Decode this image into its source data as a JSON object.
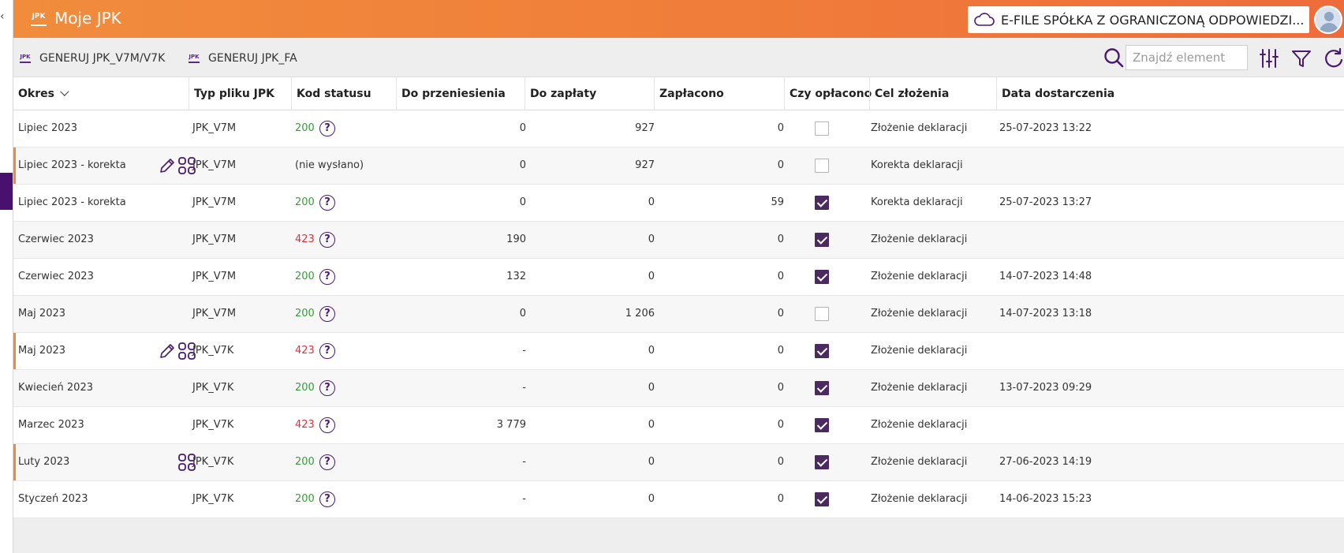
{
  "header": {
    "logo_text": "JPK",
    "title": "Moje JPK",
    "company": "E-FILE SPÓŁKA Z OGRANICZONĄ ODPOWIEDZI..."
  },
  "toolbar": {
    "buttons": [
      {
        "icon_text": "JPK",
        "label": "GENERUJ JPK_V7M/V7K"
      },
      {
        "icon_text": "JPK",
        "label": "GENERUJ JPK_FA"
      }
    ],
    "search_placeholder": "Znajdź element",
    "icons": [
      "search-icon",
      "column-settings-icon",
      "filter-icon",
      "refresh-icon"
    ]
  },
  "table": {
    "columns": [
      "Okres",
      "Typ pliku JPK",
      "Kod statusu",
      "Do przeniesienia",
      "Do zapłaty",
      "Zapłacono",
      "Czy opłacono",
      "Cel złożenia",
      "Data dostarczenia"
    ],
    "rows": [
      {
        "okres": "Lipiec 2023",
        "typ": "JPK_V7M",
        "kod": "200",
        "przen": "0",
        "zapl": "927",
        "zaplac": "0",
        "paid": false,
        "cel": "Złożenie deklaracji",
        "data": "25-07-2023 13:22",
        "flag": false,
        "edit": false,
        "apps": false
      },
      {
        "okres": "Lipiec 2023 - korekta",
        "typ": "JPK_V7M",
        "kod": "(nie wysłano)",
        "przen": "0",
        "zapl": "927",
        "zaplac": "0",
        "paid": false,
        "cel": "Korekta deklaracji",
        "data": "",
        "flag": true,
        "edit": true,
        "apps": true
      },
      {
        "okres": "Lipiec 2023 - korekta",
        "typ": "JPK_V7M",
        "kod": "200",
        "przen": "0",
        "zapl": "0",
        "zaplac": "59",
        "paid": true,
        "cel": "Korekta deklaracji",
        "data": "25-07-2023 13:27",
        "flag": false,
        "edit": false,
        "apps": false
      },
      {
        "okres": "Czerwiec 2023",
        "typ": "JPK_V7M",
        "kod": "423",
        "przen": "190",
        "zapl": "0",
        "zaplac": "0",
        "paid": true,
        "cel": "Złożenie deklaracji",
        "data": "",
        "flag": false,
        "edit": false,
        "apps": false
      },
      {
        "okres": "Czerwiec 2023",
        "typ": "JPK_V7M",
        "kod": "200",
        "przen": "132",
        "zapl": "0",
        "zaplac": "0",
        "paid": true,
        "cel": "Złożenie deklaracji",
        "data": "14-07-2023 14:48",
        "flag": false,
        "edit": false,
        "apps": false
      },
      {
        "okres": "Maj 2023",
        "typ": "JPK_V7M",
        "kod": "200",
        "przen": "0",
        "zapl": "1 206",
        "zaplac": "0",
        "paid": false,
        "cel": "Złożenie deklaracji",
        "data": "14-07-2023 13:18",
        "flag": false,
        "edit": false,
        "apps": false
      },
      {
        "okres": "Maj 2023",
        "typ": "JPK_V7K",
        "kod": "423",
        "przen": "-",
        "zapl": "0",
        "zaplac": "0",
        "paid": true,
        "cel": "Złożenie deklaracji",
        "data": "",
        "flag": true,
        "edit": true,
        "apps": true
      },
      {
        "okres": "Kwiecień 2023",
        "typ": "JPK_V7K",
        "kod": "200",
        "przen": "-",
        "zapl": "0",
        "zaplac": "0",
        "paid": true,
        "cel": "Złożenie deklaracji",
        "data": "13-07-2023 09:29",
        "flag": false,
        "edit": false,
        "apps": false
      },
      {
        "okres": "Marzec 2023",
        "typ": "JPK_V7K",
        "kod": "423",
        "przen": "3 779",
        "zapl": "0",
        "zaplac": "0",
        "paid": true,
        "cel": "Złożenie deklaracji",
        "data": "",
        "flag": false,
        "edit": false,
        "apps": false
      },
      {
        "okres": "Luty 2023",
        "typ": "JPK_V7K",
        "kod": "200",
        "przen": "-",
        "zapl": "0",
        "zaplac": "0",
        "paid": true,
        "cel": "Złożenie deklaracji",
        "data": "27-06-2023 14:19",
        "flag": true,
        "edit": false,
        "apps": true
      },
      {
        "okres": "Styczeń 2023",
        "typ": "JPK_V7K",
        "kod": "200",
        "przen": "-",
        "zapl": "0",
        "zaplac": "0",
        "paid": true,
        "cel": "Złożenie deklaracji",
        "data": "14-06-2023 15:23",
        "flag": false,
        "edit": false,
        "apps": false
      }
    ]
  },
  "colors": {
    "header_start": "#f18c3c",
    "header_end": "#ee6c3a",
    "accent_purple": "#4b2a60",
    "status_ok": "#3a9a3a",
    "status_error": "#d8343e",
    "row_flag": "#f08a3a"
  }
}
